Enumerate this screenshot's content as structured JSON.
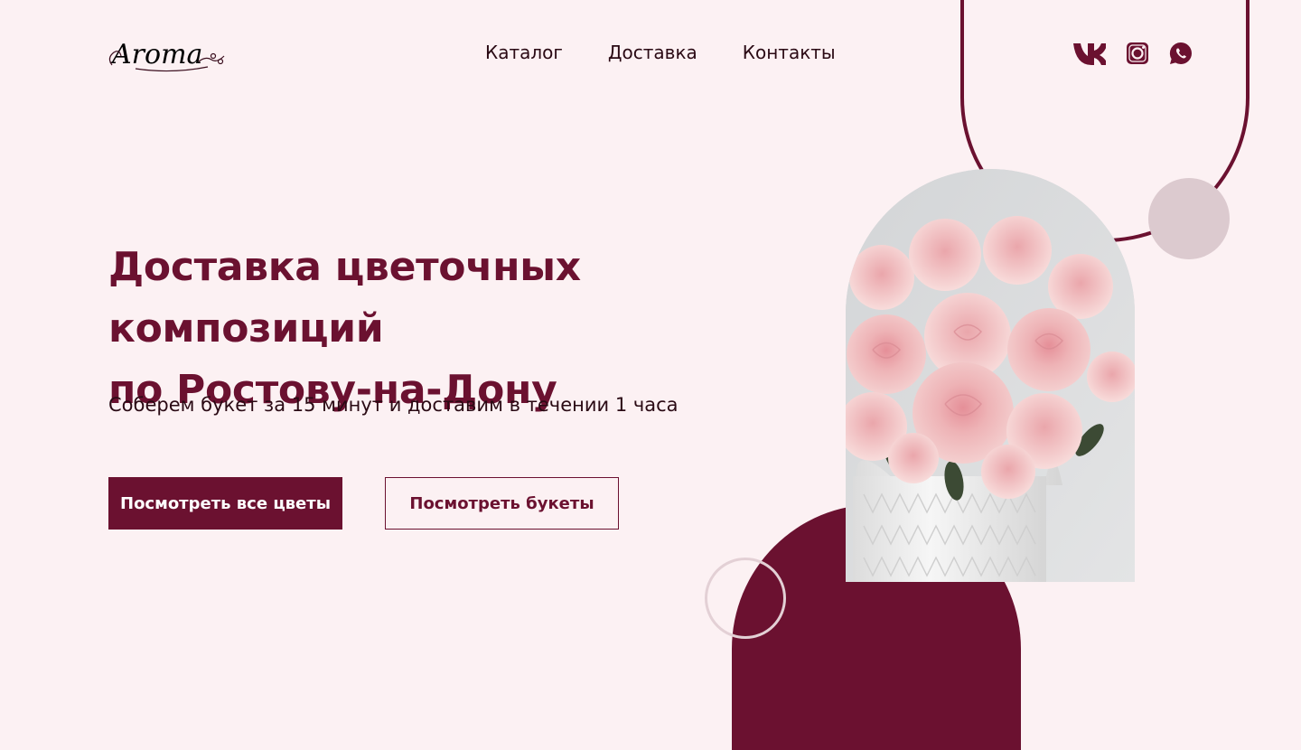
{
  "header": {
    "logo_text": "Aroma",
    "nav": [
      "Каталог",
      "Доставка",
      "Контакты"
    ],
    "social_icons": [
      "vk-icon",
      "instagram-icon",
      "whatsapp-icon"
    ]
  },
  "hero": {
    "title_line1": "Доставка цветочных композиций",
    "title_line2": "по Ростову-на-Дону",
    "subtitle": "Соберем букет за 15 минут и доставим в течении 1 часа",
    "primary_button": "Посмотреть все цветы",
    "secondary_button": "Посмотреть букеты",
    "image": "pink-peonies-bouquet-in-white-vase"
  },
  "colors": {
    "background": "#fcf1f3",
    "accent": "#6b1130",
    "accent_light": "#dccacf",
    "text": "#2a0a14"
  }
}
